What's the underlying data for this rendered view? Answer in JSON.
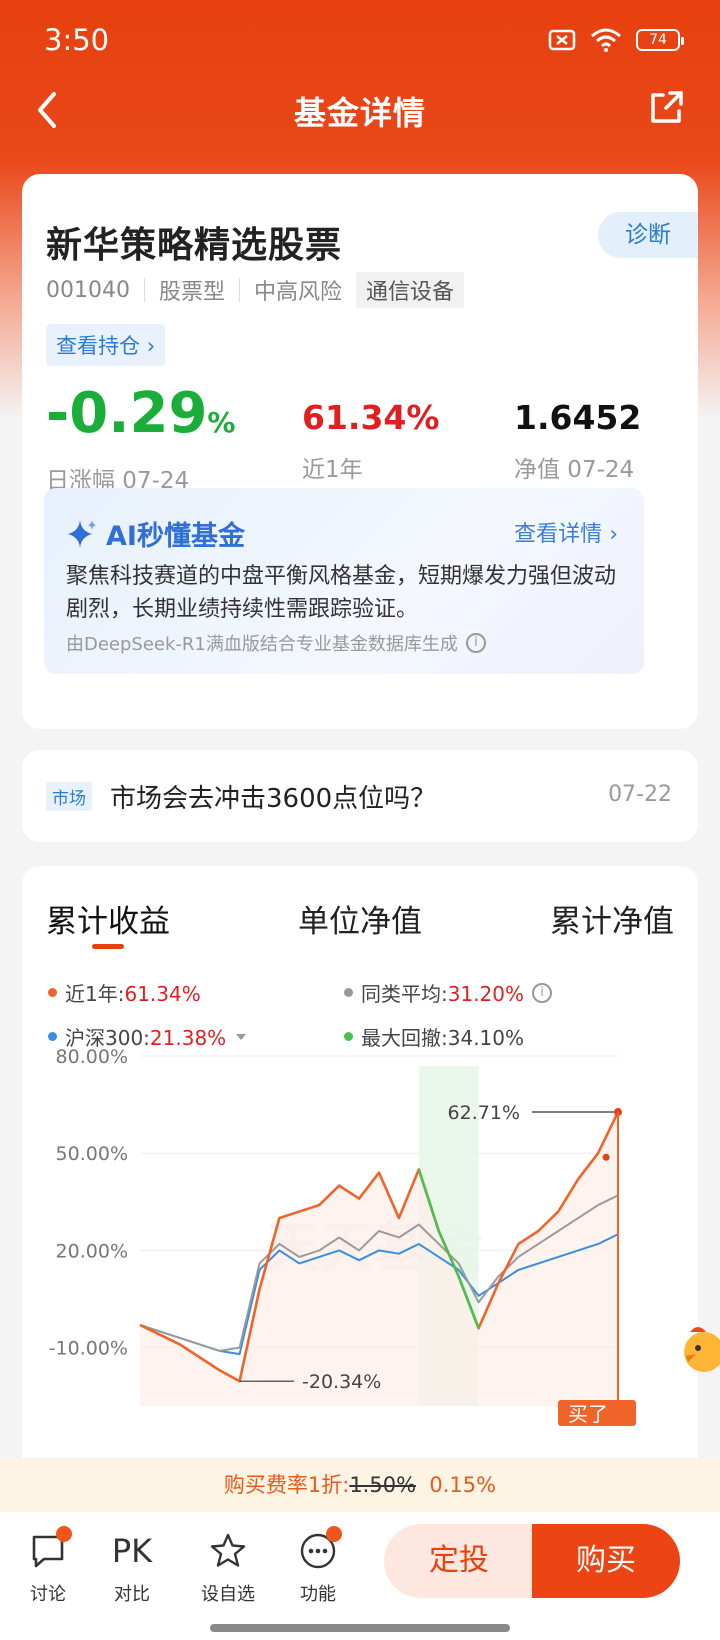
{
  "status": {
    "time": "3:50",
    "battery": "74"
  },
  "nav": {
    "title": "基金详情"
  },
  "fund": {
    "name": "新华策略精选股票",
    "diagnose_label": "诊断",
    "code": "001040",
    "type": "股票型",
    "risk": "中高风险",
    "sector": "通信设备",
    "holdings_label": "查看持仓",
    "daily_change": "-0.29",
    "daily_change_unit": "%",
    "daily_change_label": "日涨幅 07-24",
    "year_return": "61.34%",
    "year_return_label": "近1年",
    "nav_value": "1.6452",
    "nav_label": "净值 07-24"
  },
  "ai": {
    "title": "AI秒懂基金",
    "more": "查看详情",
    "text": "聚焦科技赛道的中盘平衡风格基金，短期爆发力强但波动剧烈，长期业绩持续性需跟踪验证。",
    "source": "由DeepSeek-R1满血版结合专业基金数据库生成"
  },
  "news": {
    "tag": "市场",
    "title": "市场会去冲击3600点位吗？",
    "date": "07-22"
  },
  "chart_tabs": [
    "累计收益",
    "单位净值",
    "累计净值"
  ],
  "legend": {
    "near1y_label": "近1年:",
    "near1y_value": "61.34%",
    "peer_label": "同类平均:",
    "peer_value": "31.20%",
    "hs300_label": "沪深300:",
    "hs300_value": "21.38%",
    "drawdown_label": "最大回撤:",
    "drawdown_value": "34.10%"
  },
  "chart_data": {
    "type": "line",
    "yticks": [
      "80.00%",
      "50.00%",
      "20.00%",
      "-10.00%"
    ],
    "ylim": [
      -20.34,
      80
    ],
    "annotations": {
      "max": "62.71%",
      "min": "-20.34%"
    },
    "watermark": "天天基金",
    "buy_marker": "买了",
    "series": [
      {
        "name": "近1年",
        "color": "#f0642a",
        "values": [
          -3,
          -6,
          -9,
          -13,
          -17,
          -20.34,
          8,
          30,
          32,
          34,
          40,
          36,
          44,
          30,
          45,
          26,
          12,
          -4,
          10,
          22,
          26,
          32,
          42,
          50,
          62.71
        ]
      },
      {
        "name": "同类平均",
        "color": "#9b9b9b",
        "values": [
          -3,
          -5,
          -7,
          -9,
          -11,
          -10,
          16,
          22,
          18,
          20,
          24,
          20,
          26,
          24,
          28,
          22,
          16,
          4,
          12,
          18,
          22,
          26,
          30,
          34,
          37
        ]
      },
      {
        "name": "沪深300",
        "color": "#3a8ee0",
        "values": [
          -3,
          -5,
          -7,
          -9,
          -11,
          -12,
          14,
          20,
          16,
          18,
          20,
          17,
          20,
          19,
          22,
          18,
          14,
          6,
          10,
          14,
          16,
          18,
          20,
          22,
          25
        ]
      }
    ]
  },
  "fee": {
    "prefix": "购买费率1折:",
    "old": "1.50%",
    "new": "0.15%"
  },
  "toolbar": {
    "discuss": "讨论",
    "compare_icon": "PK",
    "compare": "对比",
    "watch": "设自选",
    "more": "功能",
    "dingtou": "定投",
    "buy": "购买"
  }
}
